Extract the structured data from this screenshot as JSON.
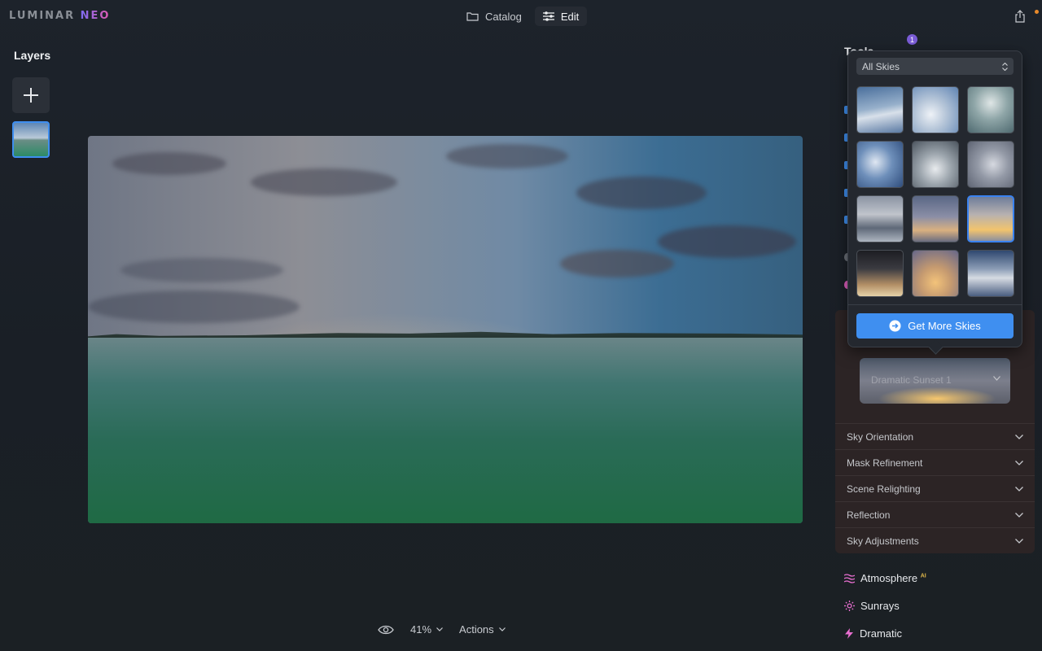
{
  "app": {
    "logo_main": "LUMINAR",
    "logo_accent": "NEO"
  },
  "topnav": {
    "catalog_label": "Catalog",
    "edit_label": "Edit"
  },
  "layers": {
    "title": "Layers"
  },
  "bottom_bar": {
    "zoom": "41%",
    "actions_label": "Actions"
  },
  "right_panel": {
    "tabs_partial": "Tools",
    "badge_count": "1",
    "selected_sky_label": "Dramatic Sunset 1",
    "sections": [
      "Sky Orientation",
      "Mask Refinement",
      "Scene Relighting",
      "Reflection",
      "Sky Adjustments"
    ],
    "tools": [
      {
        "label": "Atmosphere",
        "ai": "AI",
        "icon": "waves-icon",
        "color": "#e86fd0"
      },
      {
        "label": "Sunrays",
        "ai": "",
        "icon": "sun-icon",
        "color": "#e86fd0"
      },
      {
        "label": "Dramatic",
        "ai": "",
        "icon": "bolt-icon",
        "color": "#e86fd0"
      }
    ]
  },
  "sky_popup": {
    "filter_value": "All Skies",
    "get_more_label": "Get More Skies",
    "selected_index": 8,
    "thumbnails": [
      "sky-1",
      "sky-2",
      "sky-3",
      "sky-4",
      "sky-5",
      "sky-6",
      "sky-7",
      "sky-8",
      "sky-9",
      "sky-10",
      "sky-11",
      "sky-12"
    ]
  },
  "colors": {
    "accent": "#3f8ff0",
    "badge": "#7a5cd6",
    "tool_icon": "#e86fd0",
    "panel_bg": "#2c2425"
  }
}
